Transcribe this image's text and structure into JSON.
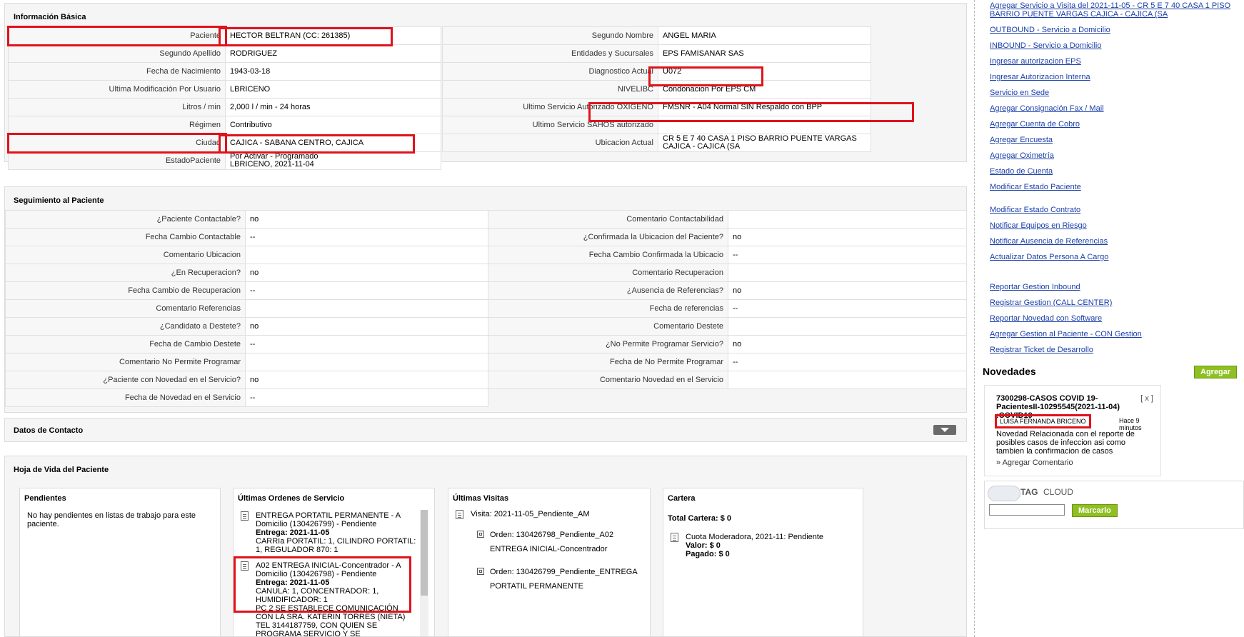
{
  "basic_info": {
    "title": "Información Básica",
    "left": [
      {
        "label": "Paciente",
        "value": "HECTOR BELTRAN (CC: 261385)"
      },
      {
        "label": "Segundo Apellido",
        "value": "RODRIGUEZ"
      },
      {
        "label": "Fecha de Nacimiento",
        "value": "1943-03-18"
      },
      {
        "label": "Ultima Modificación Por Usuario",
        "value": "LBRICENO"
      },
      {
        "label": "Litros / min",
        "value": "2,000 l / min - 24 horas"
      },
      {
        "label": "Régimen",
        "value": "Contributivo"
      },
      {
        "label": "Ciudad",
        "value": "CAJICA - SABANA CENTRO, CAJICA"
      },
      {
        "label": "EstadoPaciente",
        "value": "Por Activar - Programado",
        "value2": "LBRICENO, 2021-11-04"
      }
    ],
    "right": [
      {
        "label": "Segundo Nombre",
        "value": "ANGEL MARIA"
      },
      {
        "label": "Entidades y Sucursales",
        "value": "EPS FAMISANAR SAS"
      },
      {
        "label": "Diagnostico Actual",
        "value": "U072"
      },
      {
        "label": "NIVELIBC",
        "value": "Condonacion Por EPS CM"
      },
      {
        "label": "Ultimo Servicio Autorizado OXIGENO",
        "value": "FMSNR - A04 Normal SIN Respaldo con BPP"
      },
      {
        "label": "Ultimo Servicio SAHOS autorizado",
        "value": ""
      },
      {
        "label": "Ubicacion Actual",
        "value": "CR 5 E 7 40 CASA 1 PISO BARRIO PUENTE VARGAS CAJICA - CAJICA (SA"
      }
    ]
  },
  "seguimiento": {
    "title": "Seguimiento al Paciente",
    "left": [
      {
        "label": "¿Paciente Contactable?",
        "value": "no"
      },
      {
        "label": "Fecha Cambio Contactable",
        "value": "--"
      },
      {
        "label": "Comentario Ubicacion",
        "value": ""
      },
      {
        "label": "¿En Recuperacion?",
        "value": "no"
      },
      {
        "label": "Fecha Cambio de Recuperacion",
        "value": "--"
      },
      {
        "label": "Comentario Referencias",
        "value": ""
      },
      {
        "label": "¿Candidato a Destete?",
        "value": "no"
      },
      {
        "label": "Fecha de Cambio Destete",
        "value": "--"
      },
      {
        "label": "Comentario No Permite Programar",
        "value": ""
      },
      {
        "label": "¿Paciente con Novedad en el Servicio?",
        "value": "no"
      },
      {
        "label": "Fecha de Novedad en el Servicio",
        "value": "--"
      }
    ],
    "right": [
      {
        "label": "Comentario Contactabilidad",
        "value": ""
      },
      {
        "label": "¿Confirmada la Ubicacion del Paciente?",
        "value": "no"
      },
      {
        "label": "Fecha Cambio Confirmada la Ubicacio",
        "value": "--"
      },
      {
        "label": "Comentario Recuperacion",
        "value": ""
      },
      {
        "label": "¿Ausencia de Referencias?",
        "value": "no"
      },
      {
        "label": "Fecha de referencias",
        "value": "--"
      },
      {
        "label": "Comentario Destete",
        "value": ""
      },
      {
        "label": "¿No Permite Programar Servicio?",
        "value": "no"
      },
      {
        "label": "Fecha de No Permite Programar",
        "value": "--"
      },
      {
        "label": "Comentario Novedad en el Servicio",
        "value": ""
      }
    ]
  },
  "contacto": {
    "title": "Datos de Contacto"
  },
  "hoja_vida": {
    "title": "Hoja de Vida del Paciente",
    "pendientes": {
      "title": "Pendientes",
      "text": "No hay pendientes en listas de trabajo para este paciente."
    },
    "ordenes": {
      "title": "Últimas Ordenes de Servicio",
      "items": [
        {
          "head": "ENTREGA PORTATIL PERMANENTE - A Domicilio (130426799) - Pendiente",
          "entrega": "Entrega: 2021-11-05",
          "detail": "CARRIa PORTATIL: 1, CILINDRO PORTATIL: 1, REGULADOR 870: 1"
        },
        {
          "head": "A02 ENTREGA INICIAL-Concentrador - A Domicilio (130426798) - Pendiente",
          "entrega": "Entrega: 2021-11-05",
          "detail": "CANULA: 1, CONCENTRADOR: 1, HUMIDIFICADOR: 1",
          "extra": "PC 2 SE ESTABLECE COMUNICACIÓN CON LA SRA. KATERIN TORRES (NIETA) TEL 3144187759, CON QUIEN SE PROGRAMA SERVICIO Y SE"
        }
      ]
    },
    "visitas": {
      "title": "Últimas Visitas",
      "visita": "Visita: 2021-11-05_Pendiente_AM",
      "orders": [
        {
          "line1": "Orden: 130426798_Pendiente_A02",
          "line2": "ENTREGA INICIAL-Concentrador"
        },
        {
          "line1": "Orden: 130426799_Pendiente_ENTREGA",
          "line2": "PORTATIL PERMANENTE"
        }
      ]
    },
    "cartera": {
      "title": "Cartera",
      "total": "Total Cartera: $ 0",
      "item": "Cuota Moderadora, 2021-11: Pendiente",
      "valor": "Valor: $ 0",
      "pagado": "Pagado: $ 0"
    }
  },
  "sidebar": {
    "links_a": [
      "Agregar Servicio a Visita del 2021-11-05 - CR 5 E 7 40 CASA 1 PISO",
      "BARRIO PUENTE VARGAS CAJICA - CAJICA (SA",
      "OUTBOUND - Servicio a Domicilio",
      "INBOUND - Servicio a Domicilio",
      "Ingresar autorizacion EPS",
      "Ingresar Autorizacion Interna",
      "Servicio en Sede",
      "Agregar Consignación Fax / Mail",
      "Agregar Cuenta de Cobro",
      "Agregar Encuesta",
      "Agregar Oximetría",
      "Estado de Cuenta",
      "Modificar Estado Paciente"
    ],
    "links_b": [
      "Modificar Estado Contrato",
      "Notificar Equipos en Riesgo",
      "Notificar Ausencia de Referencias",
      "Actualizar Datos Persona A Cargo"
    ],
    "links_c": [
      "Reportar Gestion Inbound",
      "Registrar Gestion (CALL CENTER)",
      "Reportar Novedad con Software",
      "Agregar Gestion al Paciente - CON Gestion",
      "Registrar Ticket de Desarrollo"
    ],
    "novedades": {
      "title": "Novedades",
      "add_label": "Agregar",
      "card": {
        "title": "7300298-CASOS COVID 19-PacientesII-10295545(2021-11-04) :COVID19",
        "close": "[ x ]",
        "user": "LUISA FERNANDA BRICENO",
        "time": "Hace 9 minutos",
        "body": "Novedad Relacionada con el reporte de posibles casos de infeccion asi como tambien la confirmacion de casos",
        "comment_link": "» Agregar Comentario"
      }
    },
    "tag_cloud": {
      "title_a": "TAG",
      "title_b": "CLOUD",
      "input_value": "",
      "button_label": "Marcarlo"
    }
  },
  "colors": {
    "highlight": "#e0121b",
    "link": "#1a3fa8",
    "green": "#8fbf20"
  }
}
